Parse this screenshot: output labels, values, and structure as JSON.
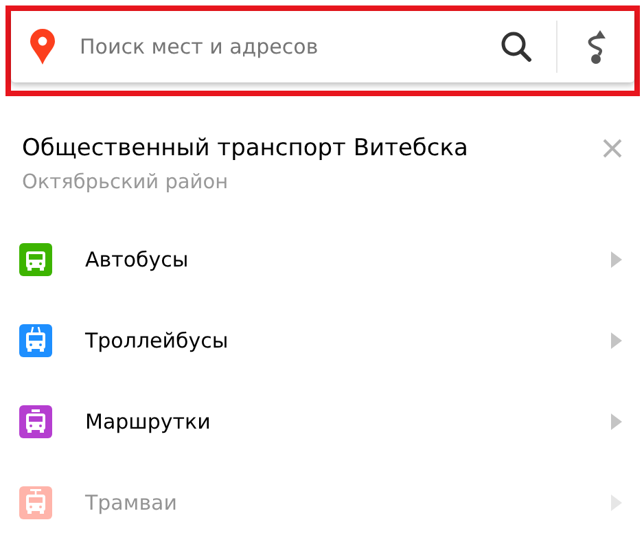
{
  "search": {
    "placeholder": "Поиск мест и адресов"
  },
  "panel": {
    "title": "Общественный транспорт Витебска",
    "subtitle": "Октябрьский район"
  },
  "transport": [
    {
      "label": "Автобусы",
      "kind": "bus",
      "color": "#3db400",
      "disabled": false
    },
    {
      "label": "Троллейбусы",
      "kind": "trolleybus",
      "color": "#1e8fff",
      "disabled": false
    },
    {
      "label": "Маршрутки",
      "kind": "minibus",
      "color": "#b53ed0",
      "disabled": false
    },
    {
      "label": "Трамваи",
      "kind": "tram",
      "color": "#ffb4aa",
      "disabled": true
    }
  ]
}
